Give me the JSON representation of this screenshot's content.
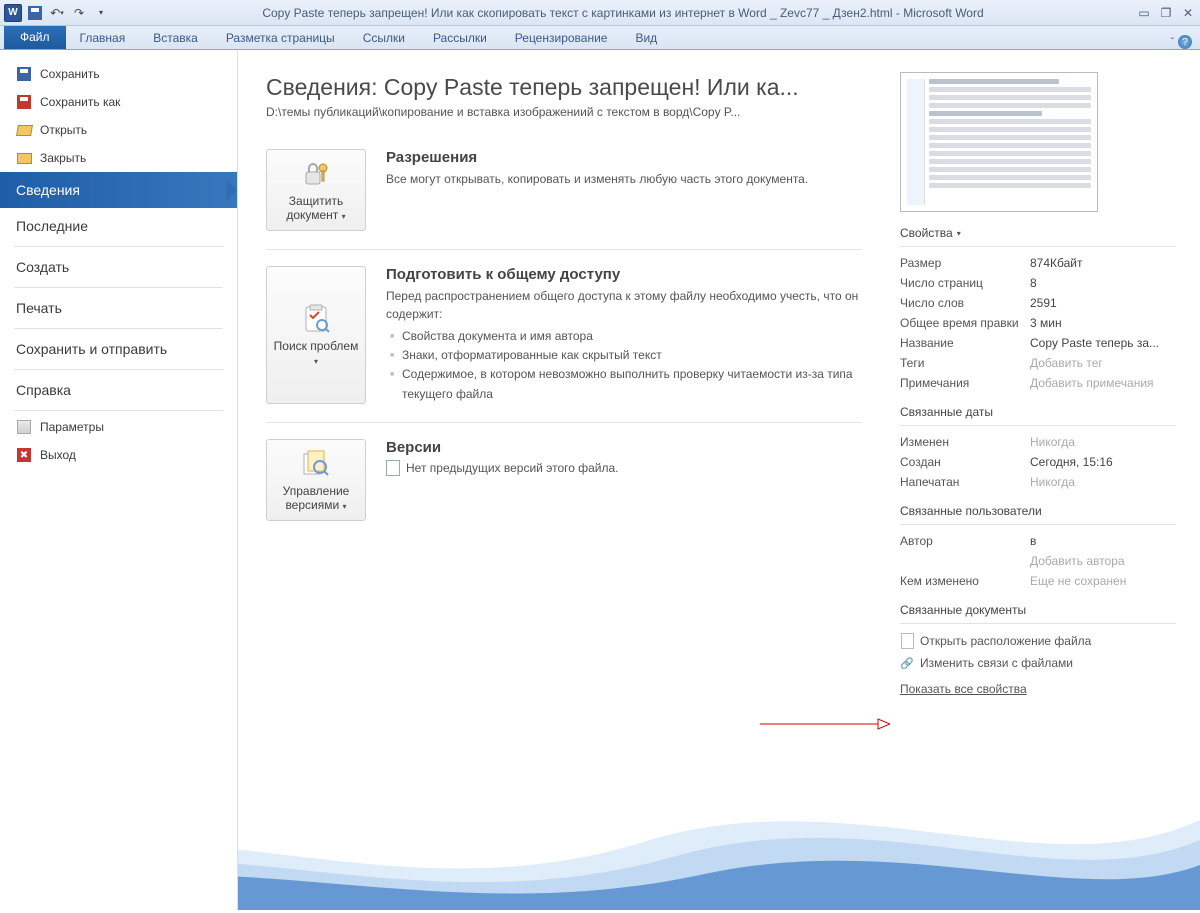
{
  "titlebar": {
    "title": "Copy Paste теперь запрещен! Или как скопировать текст с картинками из интернет в Word _ Zevc77 _ Дзен2.html  -  Microsoft Word"
  },
  "ribbon": {
    "file": "Файл",
    "tabs": [
      "Главная",
      "Вставка",
      "Разметка страницы",
      "Ссылки",
      "Рассылки",
      "Рецензирование",
      "Вид"
    ]
  },
  "sidebar": {
    "save": "Сохранить",
    "saveAs": "Сохранить как",
    "open": "Открыть",
    "close": "Закрыть",
    "info": "Сведения",
    "recent": "Последние",
    "new": "Создать",
    "print": "Печать",
    "saveSend": "Сохранить и отправить",
    "help": "Справка",
    "options": "Параметры",
    "exit": "Выход"
  },
  "info": {
    "title": "Сведения: Copy Paste теперь запрещен! Или ка...",
    "path": "D:\\темы публикаций\\копирование и вставка изображениий с текстом в ворд\\Copy P..."
  },
  "perm": {
    "btn": "Защитить документ",
    "heading": "Разрешения",
    "text": "Все могут открывать, копировать и изменять любую часть этого документа."
  },
  "prep": {
    "btn": "Поиск проблем",
    "heading": "Подготовить к общему доступу",
    "intro": "Перед распространением общего доступа к этому файлу необходимо учесть, что он содержит:",
    "items": [
      "Свойства документа и имя автора",
      "Знаки, отформатированные как скрытый текст",
      "Содержимое, в котором невозможно выполнить проверку читаемости из-за типа текущего файла"
    ]
  },
  "ver": {
    "btn": "Управление версиями",
    "heading": "Версии",
    "text": "Нет предыдущих версий этого файла."
  },
  "rp": {
    "propsHeader": "Свойства",
    "rows": {
      "size_k": "Размер",
      "size_v": "874Кбайт",
      "pages_k": "Число страниц",
      "pages_v": "8",
      "words_k": "Число слов",
      "words_v": "2591",
      "edit_k": "Общее время правки",
      "edit_v": "3 мин",
      "name_k": "Название",
      "name_v": "Copy Paste теперь за...",
      "tags_k": "Теги",
      "tags_v": "Добавить тег",
      "notes_k": "Примечания",
      "notes_v": "Добавить примечания"
    },
    "datesHeader": "Связанные даты",
    "dates": {
      "mod_k": "Изменен",
      "mod_v": "Никогда",
      "cre_k": "Создан",
      "cre_v": "Сегодня, 15:16",
      "prt_k": "Напечатан",
      "prt_v": "Никогда"
    },
    "usersHeader": "Связанные пользователи",
    "users": {
      "auth_k": "Автор",
      "auth_v": "в",
      "addAuthor": "Добавить автора",
      "mod_k": "Кем изменено",
      "mod_v": "Еще не сохранен"
    },
    "docsHeader": "Связанные документы",
    "openLoc": "Открыть расположение файла",
    "editLinks": "Изменить связи с файлами",
    "showAll": "Показать все свойства"
  }
}
